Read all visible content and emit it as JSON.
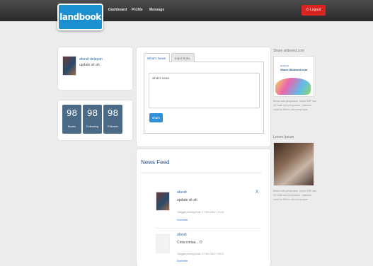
{
  "header": {
    "logo_text": "landbook",
    "nav": [
      "Dashboard",
      "Profile",
      "Message"
    ],
    "logout_label": "Logout"
  },
  "profile": {
    "name": "afandi delapan",
    "status": "update sit ah"
  },
  "stats": [
    {
      "value": "98",
      "label": "Books"
    },
    {
      "value": "98",
      "label": "Following"
    },
    {
      "value": "98",
      "label": "Follower"
    }
  ],
  "post": {
    "tabs": [
      "What's News",
      "Input Buku"
    ],
    "text": "what's news",
    "share_label": "share"
  },
  "feed": {
    "title": "News Feed",
    "items": [
      {
        "name": "afandi",
        "text": "update sit ah",
        "date": "Tanggal posting Ahad, 27 Mei 2012 | 21:46",
        "comment": "Komentar",
        "close": "X"
      },
      {
        "name": "afandi",
        "text": "Cinta cintaa... D",
        "date": "Tanggal posting Ahad, 27 Mei 2012 | 09:11",
        "comment": "Komentar"
      }
    ]
  },
  "sidebar": {
    "ad1": {
      "title": "Share slidesed.com",
      "image_top": "landbook",
      "image_main": "Share-Slidesed.com",
      "text": "Belum ada penyusaan. Untuk SMP dan SD tidak ada penyusaan . silahkan untuk ke Belum ada penyusaan"
    },
    "ad2": {
      "title": "Lorem Ipsum",
      "text": "Belum ada penyusaan. Untuk SMP dan SD tidak ada penyusaan . silahkan untuk ke Belum ada penyusaan"
    }
  },
  "colors": {
    "brand": "#1b8fcf",
    "logout": "#d9241f",
    "stat_tile": "#4a6a86",
    "link": "#2b6db5"
  }
}
